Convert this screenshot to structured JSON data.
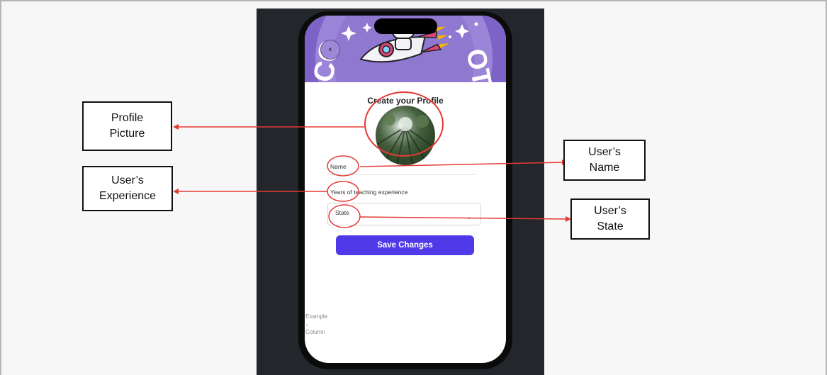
{
  "app": {
    "header_text": "CO   OT",
    "title": "Create your Profile",
    "fields": {
      "name_label": "Name",
      "experience_label": "Years of teaching experience",
      "state_label": "State"
    },
    "save_label": "Save Changes",
    "example_lines": [
      "Example",
      "↓",
      "Column"
    ]
  },
  "callouts": {
    "profile_picture": "Profile\nPicture",
    "user_experience": "User’s\nExperience",
    "user_name": "User’s\nName",
    "user_state": "User’s\nState"
  },
  "colors": {
    "header_purple": "#7d63c7",
    "button_blue": "#4f39e8",
    "annotation_red": "#e53935"
  }
}
